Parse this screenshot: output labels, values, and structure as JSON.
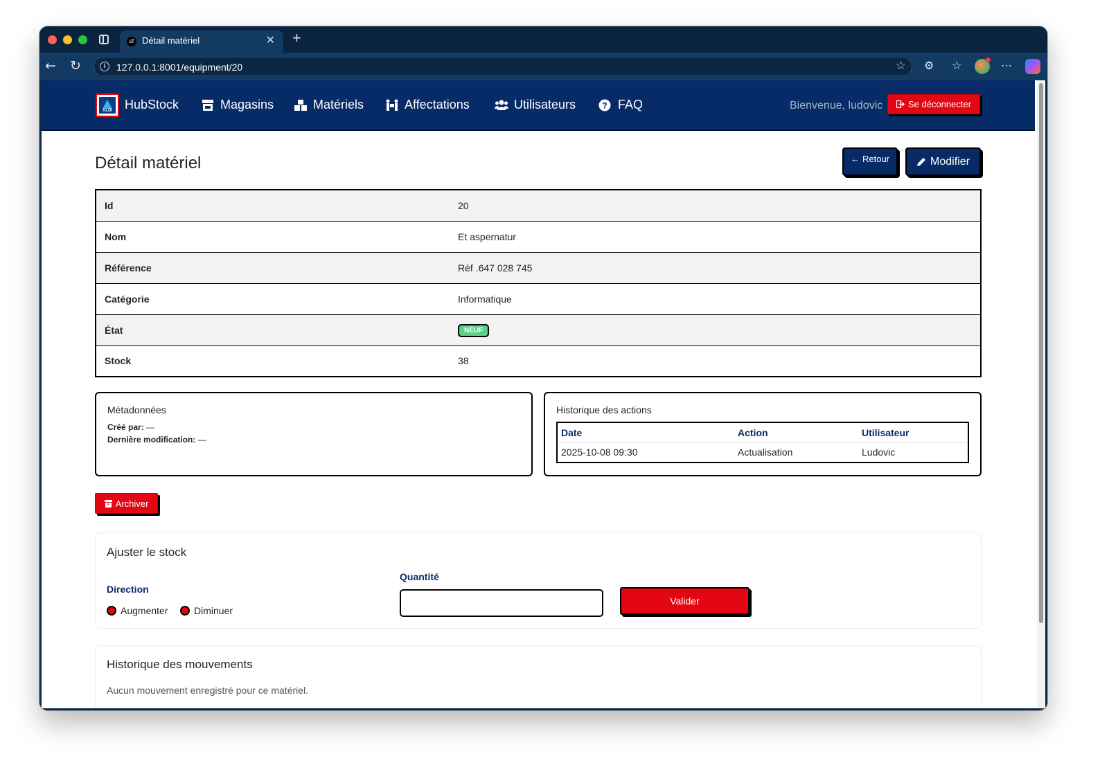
{
  "browser": {
    "tab_title": "Détail matériel",
    "tab_favicon": "sf",
    "url": "127.0.0.1:8001/equipment/20"
  },
  "nav": {
    "brand": "HubStock",
    "logo_text": "ALDI",
    "links": [
      {
        "label": "Magasins",
        "icon": "store-icon"
      },
      {
        "label": "Matériels",
        "icon": "boxes-icon"
      },
      {
        "label": "Affectations",
        "icon": "people-carry-icon"
      },
      {
        "label": "Utilisateurs",
        "icon": "users-icon"
      },
      {
        "label": "FAQ",
        "icon": "question-circle-icon"
      }
    ],
    "welcome": "Bienvenue, ludovic",
    "logout_label": "Se déconnecter"
  },
  "page": {
    "title": "Détail matériel",
    "back_label": "Retour",
    "edit_label": "Modifier"
  },
  "details": [
    {
      "key": "Id",
      "value": "20"
    },
    {
      "key": "Nom",
      "value": "Et aspernatur"
    },
    {
      "key": "Référence",
      "value": "Réf .647 028 745"
    },
    {
      "key": "Catégorie",
      "value": "Informatique"
    },
    {
      "key": "État",
      "value": "NEUF",
      "badge_color": "#5cd08a"
    },
    {
      "key": "Stock",
      "value": "38"
    }
  ],
  "metadata": {
    "title": "Métadonnées",
    "created_by_label": "Créé par:",
    "created_by_value": "—",
    "modified_label": "Dernière modification:",
    "modified_value": "—"
  },
  "history": {
    "title": "Historique des actions",
    "columns": [
      "Date",
      "Action",
      "Utilisateur"
    ],
    "rows": [
      [
        "2025-10-08 09:30",
        "Actualisation",
        "Ludovic"
      ]
    ]
  },
  "archive_label": "Archiver",
  "stock_adjust": {
    "title": "Ajuster le stock",
    "direction_label": "Direction",
    "options": [
      "Augmenter",
      "Diminuer"
    ],
    "quantity_label": "Quantité",
    "quantity_value": "",
    "submit_label": "Valider"
  },
  "movements": {
    "title": "Historique des mouvements",
    "empty_text": "Aucun mouvement enregistré pour ce matériel."
  },
  "colors": {
    "navy": "#062b66",
    "red": "#e30613",
    "badge_green": "#5cd08a"
  }
}
